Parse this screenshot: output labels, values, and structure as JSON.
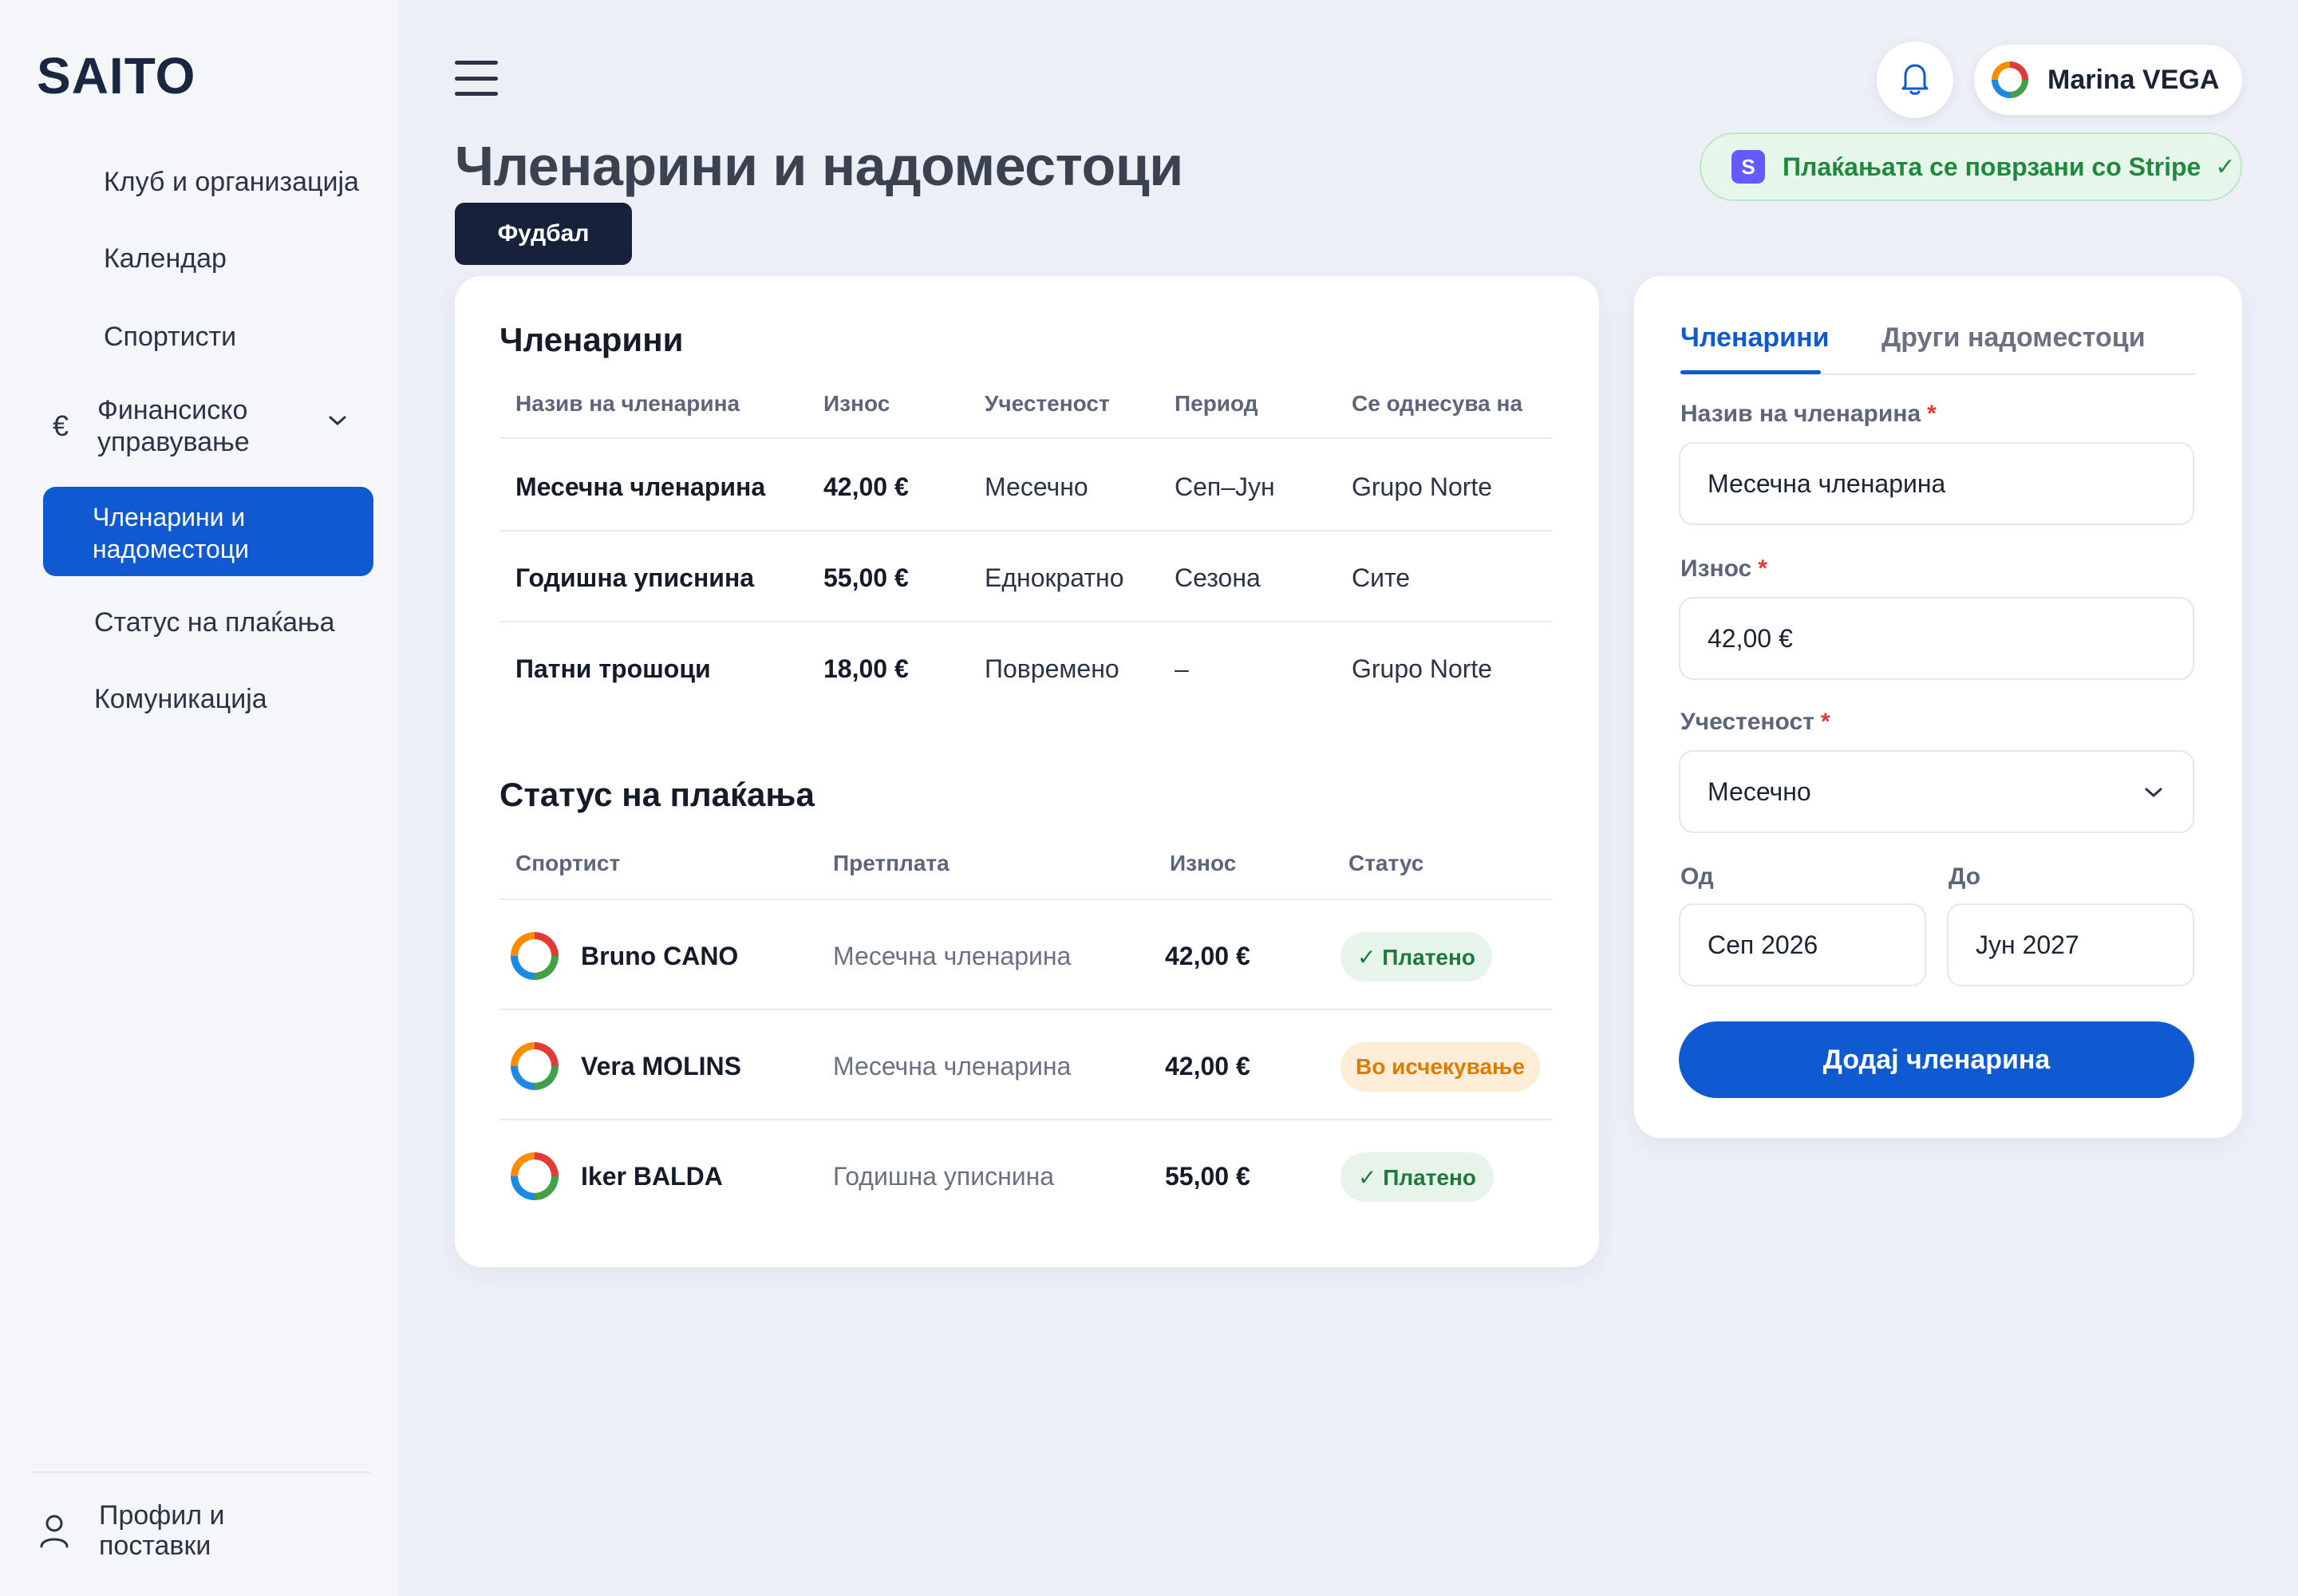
{
  "app": {
    "logo": "SAITO"
  },
  "sidebar": {
    "items": [
      {
        "label": "Клуб и организација"
      },
      {
        "label": "Календар"
      },
      {
        "label": "Спортисти"
      }
    ],
    "group": {
      "label_line1": "Финансиско",
      "label_line2": "управување",
      "icon": "euro-icon"
    },
    "active": {
      "label_line1": "Членарини и",
      "label_line2": "надоместоци"
    },
    "children": [
      {
        "label": "Статус на плаќања"
      },
      {
        "label": "Комуникација"
      }
    ],
    "profile": {
      "line1": "Профил и",
      "line2": "поставки"
    }
  },
  "header": {
    "user_name": "Marina VEGA",
    "page_title": "Членарини и надоместоци",
    "stripe_text": "Плаќањата се поврзани со Stripe",
    "stripe_logo": "S",
    "sport_chip": "Фудбал"
  },
  "fees": {
    "title": "Членарини",
    "columns": [
      "Назив на членарина",
      "Износ",
      "Учестеност",
      "Период",
      "Се однесува на"
    ],
    "rows": [
      [
        "Месечна членарина",
        "42,00 €",
        "Месечно",
        "Сеп–Јун",
        "Grupo Norte"
      ],
      [
        "Годишна уписнина",
        "55,00 €",
        "Еднократно",
        "Сезона",
        "Сите"
      ],
      [
        "Патни трошоци",
        "18,00 €",
        "Повремено",
        "–",
        "Grupo Norte"
      ]
    ]
  },
  "payments": {
    "title": "Статус на плаќања",
    "columns": [
      "Спортист",
      "Претплата",
      "Износ",
      "Статус"
    ],
    "rows": [
      {
        "athlete": "Bruno CANO",
        "plan": "Месечна членарина",
        "amount": "42,00 €",
        "status": "✓ Платено",
        "status_type": "paid"
      },
      {
        "athlete": "Vera MOLINS",
        "plan": "Месечна членарина",
        "amount": "42,00 €",
        "status": "Во исчекување",
        "status_type": "pending"
      },
      {
        "athlete": "Iker BALDA",
        "plan": "Годишна уписнина",
        "amount": "55,00 €",
        "status": "✓ Платено",
        "status_type": "paid"
      }
    ]
  },
  "form": {
    "tabs": [
      "Членарини",
      "Други надоместоци"
    ],
    "name_label": "Назив на членарина",
    "name_value": "Месечна членарина",
    "amount_label": "Износ",
    "amount_value": "42,00 €",
    "frequency_label": "Учестеност",
    "frequency_value": "Месечно",
    "from_label": "Од",
    "from_value": "Сеп 2026",
    "to_label": "До",
    "to_value": "Јун 2027",
    "required_mark": "*",
    "submit_label": "Додај членарина"
  },
  "colors": {
    "accent": "#0f5ad1",
    "paid": "#1f7a3a",
    "pending": "#e07a00",
    "stripe": "#635bff"
  }
}
